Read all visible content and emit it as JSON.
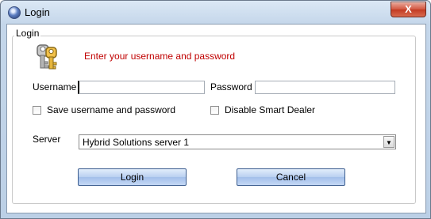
{
  "window": {
    "title": "Login",
    "close_label": "X"
  },
  "group": {
    "label": "Login"
  },
  "prompt": "Enter your username and password",
  "fields": {
    "username_label": "Username",
    "username_value": "",
    "password_label": "Password",
    "password_value": ""
  },
  "options": {
    "save_label": "Save username and password",
    "save_checked": false,
    "disable_label": "Disable Smart Dealer",
    "disable_checked": false
  },
  "server": {
    "label": "Server",
    "selected": "Hybrid Solutions server 1"
  },
  "buttons": {
    "login": "Login",
    "cancel": "Cancel"
  },
  "icons": {
    "title": "globe-icon",
    "dialog": "keys-icon",
    "dropdown": "chevron-down-icon"
  },
  "colors": {
    "prompt": "#c00000",
    "close_button": "#c9452c"
  }
}
